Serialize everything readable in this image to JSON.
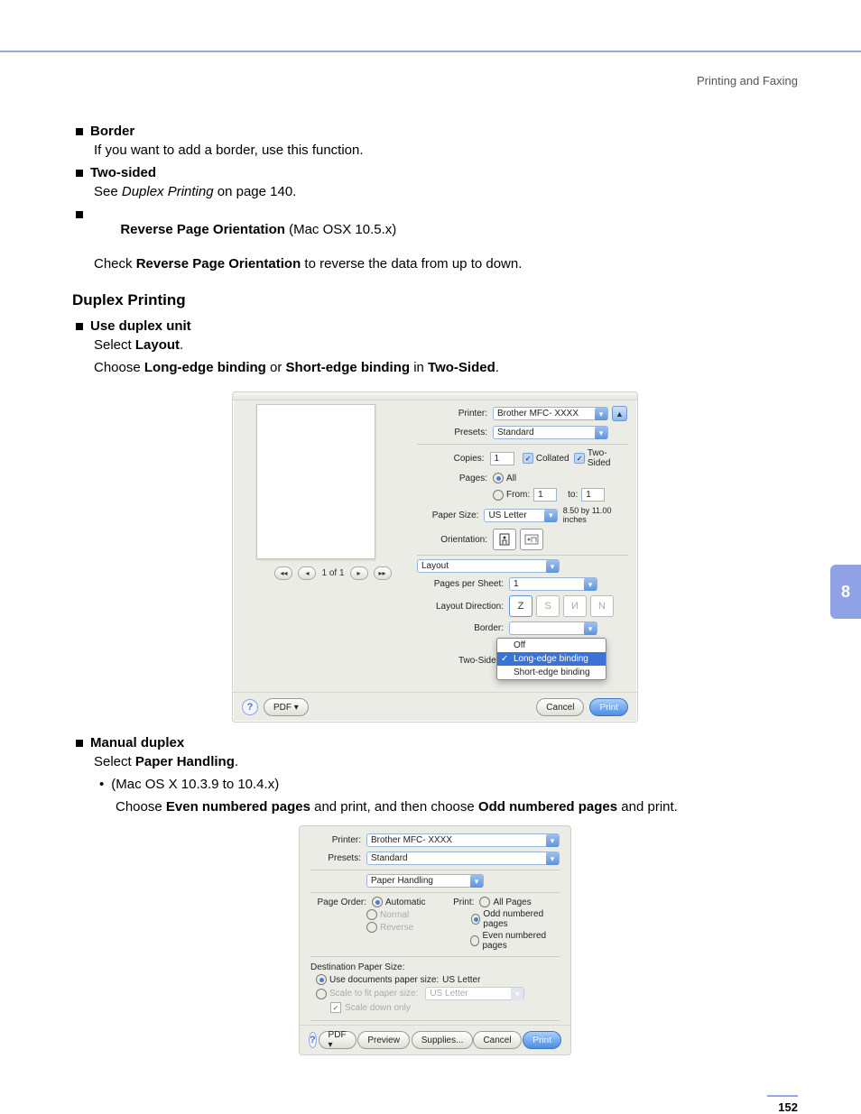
{
  "header": {
    "section": "Printing and Faxing"
  },
  "sideTab": "8",
  "pageNumber": "152",
  "bullets": {
    "border": {
      "title": "Border",
      "body": "If you want to add a border, use this function."
    },
    "twoSided": {
      "title": "Two-sided",
      "body_pre": "See ",
      "body_em": "Duplex Printing",
      "body_post": " on page 140."
    },
    "reverse": {
      "title": "Reverse Page Orientation",
      "title_suffix": " (Mac OSX 10.5.x)",
      "body_pre": "Check ",
      "body_bold": "Reverse Page Orientation",
      "body_post": " to reverse the data from up to down."
    }
  },
  "duplexSection": {
    "heading": "Duplex Printing",
    "useDuplex": {
      "title": "Use duplex unit",
      "line1_pre": "Select ",
      "line1_bold": "Layout",
      "line1_post": ".",
      "line2_pre": "Choose ",
      "line2_b1": "Long-edge binding",
      "line2_mid": " or ",
      "line2_b2": "Short-edge binding",
      "line2_mid2": " in ",
      "line2_b3": "Two-Sided",
      "line2_post": "."
    },
    "manualDuplex": {
      "title": "Manual duplex",
      "line1_pre": "Select ",
      "line1_bold": "Paper Handling",
      "line1_post": ".",
      "sub_marker": "•",
      "sub_text": "(Mac OS X 10.3.9 to 10.4.x)",
      "line2_pre": "Choose ",
      "line2_b1": "Even numbered pages",
      "line2_mid": " and print, and then choose ",
      "line2_b2": "Odd numbered pages",
      "line2_post": " and print."
    }
  },
  "dlg1": {
    "pager": {
      "count": "1 of 1"
    },
    "printer": {
      "label": "Printer:",
      "value": "Brother MFC- XXXX"
    },
    "presets": {
      "label": "Presets:",
      "value": "Standard"
    },
    "copies": {
      "label": "Copies:",
      "value": "1",
      "collated": "Collated",
      "twoSided": "Two-Sided"
    },
    "pages": {
      "label": "Pages:",
      "all": "All",
      "fromLabel": "From:",
      "fromVal": "1",
      "toLabel": "to:",
      "toVal": "1"
    },
    "paperSize": {
      "label": "Paper Size:",
      "value": "US Letter",
      "dims": "8.50 by 11.00 inches"
    },
    "orientation": {
      "label": "Orientation:"
    },
    "panel": "Layout",
    "pagesPerSheet": {
      "label": "Pages per Sheet:",
      "value": "1"
    },
    "layoutDirection": {
      "label": "Layout Direction:"
    },
    "border": {
      "label": "Border:"
    },
    "twoSidedRow": {
      "label": "Two-Sided:"
    },
    "menu": {
      "off": "Off",
      "long": "Long-edge binding",
      "short": "Short-edge binding"
    },
    "help": "?",
    "pdf": "PDF ▾",
    "cancel": "Cancel",
    "print": "Print"
  },
  "dlg2": {
    "printer": {
      "label": "Printer:",
      "value": "Brother MFC- XXXX"
    },
    "presets": {
      "label": "Presets:",
      "value": "Standard"
    },
    "panel": "Paper Handling",
    "pageOrder": {
      "label": "Page Order:",
      "auto": "Automatic",
      "normal": "Normal",
      "reverse": "Reverse"
    },
    "printCol": {
      "label": "Print:",
      "all": "All Pages",
      "odd": "Odd numbered pages",
      "even": "Even numbered pages"
    },
    "dest": {
      "heading": "Destination Paper Size:",
      "useDoc": "Use documents paper size:",
      "useDocVal": "US Letter",
      "scale": "Scale to fit paper size:",
      "scaleVal": "US Letter",
      "scaleDown": "Scale down only"
    },
    "help": "?",
    "pdf": "PDF ▾",
    "preview": "Preview",
    "supplies": "Supplies...",
    "cancel": "Cancel",
    "print": "Print"
  }
}
